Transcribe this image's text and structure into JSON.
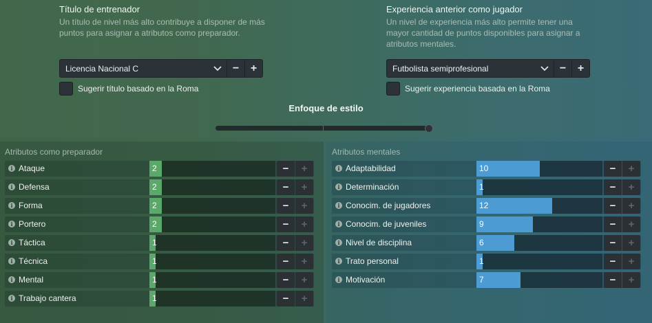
{
  "coach_title": {
    "title": "Título de entrenador",
    "description": "Un título de nivel más alto contribuye a disponer de más puntos para asignar a atributos como preparador.",
    "selected": "Licencia Nacional C",
    "checkbox_label": "Sugerir título basado en la Roma"
  },
  "player_experience": {
    "title": "Experiencia anterior como jugador",
    "description": "Un nivel de experiencia más alto permite tener una mayor cantidad de puntos disponibles para asignar a atributos mentales.",
    "selected": "Futbolista semiprofesional",
    "checkbox_label": "Sugerir experiencia basada en la Roma"
  },
  "style": {
    "title": "Enfoque de estilo",
    "slider_value": 1.0
  },
  "coaching_attributes": {
    "header": "Atributos como preparador",
    "max": 20,
    "color": "#5aa86a",
    "items": [
      {
        "label": "Ataque",
        "value": 2
      },
      {
        "label": "Defensa",
        "value": 2
      },
      {
        "label": "Forma",
        "value": 2
      },
      {
        "label": "Portero",
        "value": 2
      },
      {
        "label": "Táctica",
        "value": 1
      },
      {
        "label": "Técnica",
        "value": 1
      },
      {
        "label": "Mental",
        "value": 1
      },
      {
        "label": "Trabajo cantera",
        "value": 1
      }
    ]
  },
  "mental_attributes": {
    "header": "Atributos mentales",
    "max": 20,
    "color": "#4c9bd3",
    "items": [
      {
        "label": "Adaptabilidad",
        "value": 10
      },
      {
        "label": "Determinación",
        "value": 1
      },
      {
        "label": "Conocim. de jugadores",
        "value": 12
      },
      {
        "label": "Conocim. de juveniles",
        "value": 9
      },
      {
        "label": "Nivel de disciplina",
        "value": 6
      },
      {
        "label": "Trato personal",
        "value": 1
      },
      {
        "label": "Motivación",
        "value": 7
      }
    ]
  },
  "controls": {
    "minus": "−",
    "plus": "+",
    "info": "i"
  }
}
